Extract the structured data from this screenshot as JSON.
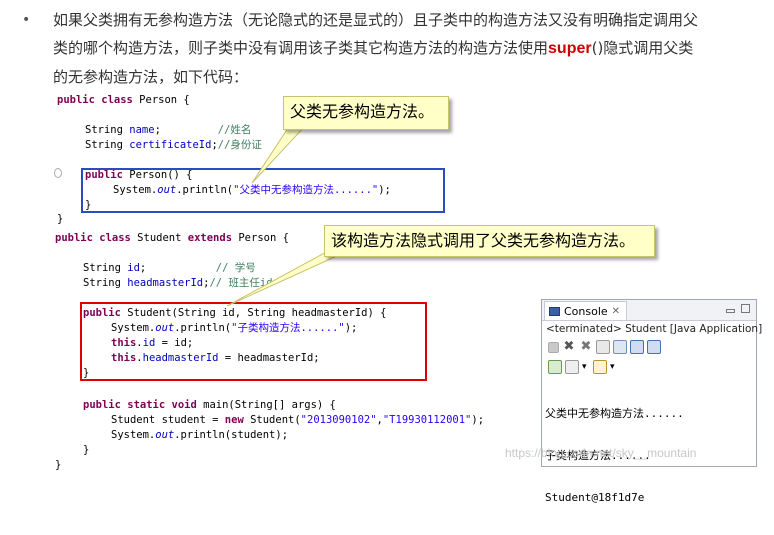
{
  "paragraph": {
    "line1": "如果父类拥有无参构造方法（无论隐式的还是显式的）且子类中的构造方法又没有明确指定调用父",
    "line2a": "类的哪个构造方法，则子类中没有调用该子类其它构造方法的构造方法使用",
    "keyword": "super",
    "line2b": "()隐式调用父类",
    "line3": "的无参构造方法，如下代码："
  },
  "callouts": {
    "top": "父类无参构造方法。",
    "middle": "该构造方法隐式调用了父类无参构造方法。"
  },
  "code": {
    "l1": "public class Person {",
    "l3": "String name;         //姓名",
    "l4": "String certificateId;//身份证",
    "l6": "public Person() {",
    "l7": "System.out.println(\"父类中无参构造方法......\");",
    "l8": "}",
    "l9": "}",
    "l10": "public class Student extends Person {",
    "l12": "String id;           // 学号",
    "l13": "String headmasterId;// 班主任id",
    "l15": "public Student(String id, String headmasterId) {",
    "l16": "System.out.println(\"子类构造方法......\");",
    "l17": "this.id = id;",
    "l18": "this.headmasterId = headmasterId;",
    "l19": "}",
    "l21": "public static void main(String[] args) {",
    "l22": "Student student = new Student(\"2013090102\",\"T19930112001\");",
    "l23": "System.out.println(student);",
    "l24": "}",
    "l25": "}"
  },
  "console": {
    "tab_label": "Console",
    "status": "<terminated> Student [Java Application]",
    "output": [
      "父类中无参构造方法......",
      "子类构造方法......",
      "Student@18f1d7e"
    ]
  },
  "watermark": "https://blog.csdn.net/sky__mountain",
  "colors": {
    "keyword": "#7f0055",
    "field": "#0000c0",
    "string": "#2a00ff",
    "comment": "#3f7f5f",
    "blue_box": "#2a4cbf",
    "red_box": "#e00000",
    "callout_bg": "#ffffc8"
  }
}
